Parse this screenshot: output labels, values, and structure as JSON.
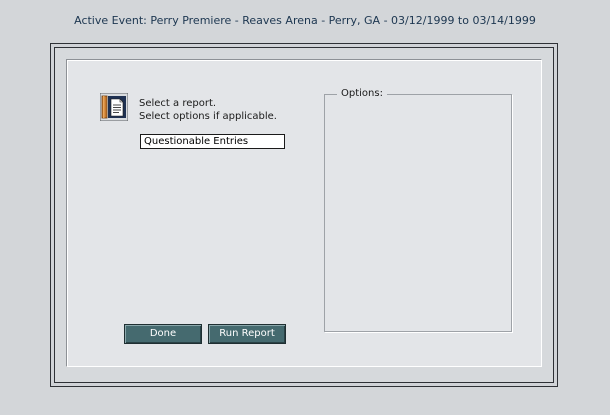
{
  "header": {
    "active_event": "Active Event:  Perry Premiere - Reaves Arena - Perry, GA - 03/12/1999 to 03/14/1999"
  },
  "report_panel": {
    "icon": "report-document-icon",
    "instruction_line1": "Select a report.",
    "instruction_line2": "Select options if applicable.",
    "selected_report": "Questionable Entries",
    "done_label": "Done",
    "run_report_label": "Run Report"
  },
  "options": {
    "label": "Options:"
  },
  "colors": {
    "background": "#d3d6d9",
    "panel": "#e3e5e8",
    "button": "#456a6f",
    "header_text": "#1c3650"
  }
}
